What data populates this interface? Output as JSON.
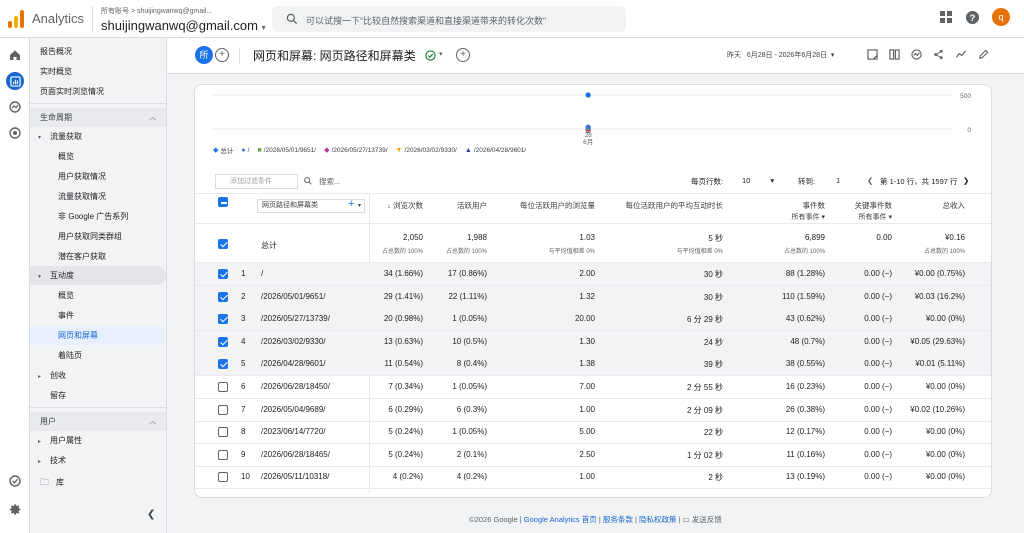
{
  "app": {
    "name": "Analytics",
    "account_path": "所有账号 > shuijingwanwq@gmail...",
    "account_name": "shuijingwanwq@gmail.com",
    "avatar_letter": "q"
  },
  "search": {
    "placeholder": "可以试搜一下“比较自然搜索渠道和直接渠道带来的转化次数”"
  },
  "nav": {
    "items": [
      {
        "label": "报告概况",
        "top": 4,
        "type": "top"
      },
      {
        "label": "实时概览",
        "top": 24,
        "type": "top"
      },
      {
        "label": "页面实时浏览情况",
        "top": 44,
        "type": "top"
      },
      {
        "label": "生命周期",
        "top": 70,
        "type": "sec"
      },
      {
        "label": "流量获取",
        "top": 89,
        "type": "group",
        "arrow": "▾"
      },
      {
        "label": "概览",
        "top": 109,
        "type": "sub"
      },
      {
        "label": "用户获取情况",
        "top": 129,
        "type": "sub"
      },
      {
        "label": "流量获取情况",
        "top": 149,
        "type": "sub"
      },
      {
        "label": "非 Google 广告系列",
        "top": 169,
        "type": "sub"
      },
      {
        "label": "用户获取同类群组",
        "top": 189,
        "type": "sub"
      },
      {
        "label": "潜在客户获取",
        "top": 209,
        "type": "sub"
      },
      {
        "label": "互动度",
        "top": 228,
        "type": "group-open",
        "arrow": "▾"
      },
      {
        "label": "概览",
        "top": 248,
        "type": "sub"
      },
      {
        "label": "事件",
        "top": 268,
        "type": "sub"
      },
      {
        "label": "网页和屏幕",
        "top": 288,
        "type": "sub-sel"
      },
      {
        "label": "着陆页",
        "top": 308,
        "type": "sub"
      },
      {
        "label": "创收",
        "top": 328,
        "type": "group",
        "arrow": "▸"
      },
      {
        "label": "留存",
        "top": 348,
        "type": "group",
        "arrow": ""
      },
      {
        "label": "用户",
        "top": 374,
        "type": "sec"
      },
      {
        "label": "用户属性",
        "top": 393,
        "type": "group",
        "arrow": "▸"
      },
      {
        "label": "技术",
        "top": 413,
        "type": "group",
        "arrow": "▸"
      },
      {
        "label": "库",
        "top": 435,
        "type": "lib"
      }
    ]
  },
  "header": {
    "title": "网页和屏幕: 网页路径和屏幕类",
    "badge": "所",
    "date_label": "昨天",
    "date_range": "6月28日 - 2026年6月28日"
  },
  "chart_data": {
    "type": "line",
    "x": [
      "6月28"
    ],
    "x_tick_labels": [
      "28",
      "6月"
    ],
    "y_ticks": [
      0,
      500
    ],
    "ylim": [
      0,
      500
    ],
    "series": [
      {
        "name": "总计",
        "color": "#1a73e8",
        "values": [
          2050
        ]
      },
      {
        "name": "/",
        "color": "#3c78d8",
        "values": [
          34
        ]
      },
      {
        "name": "/2026/05/01/9651/",
        "color": "#5ea84a",
        "values": [
          29
        ]
      },
      {
        "name": "/2026/05/27/13739/",
        "color": "#c2309e",
        "values": [
          20
        ]
      },
      {
        "name": "/2026/03/02/9330/",
        "color": "#f2a600",
        "values": [
          13
        ]
      },
      {
        "name": "/2026/04/28/9601/",
        "color": "#3b3ba8",
        "values": [
          11
        ]
      }
    ]
  },
  "legend": [
    {
      "shape": "◆",
      "color": "#1a73e8",
      "label": "总计"
    },
    {
      "shape": "●",
      "color": "#3c78d8",
      "label": "/"
    },
    {
      "shape": "■",
      "color": "#5ea84a",
      "label": "/2026/05/01/9651/"
    },
    {
      "shape": "◆",
      "color": "#c2309e",
      "label": "/2026/05/27/13739/"
    },
    {
      "shape": "▼",
      "color": "#f2a600",
      "label": "/2026/03/02/9330/"
    },
    {
      "shape": "▲",
      "color": "#3b3ba8",
      "label": "/2026/04/28/9601/"
    }
  ],
  "toolbar": {
    "filter_placeholder": "添加过滤条件",
    "search_placeholder": "搜索...",
    "rows_per_page_label": "每页行数:",
    "rows_per_page": "10",
    "goto_label": "转到:",
    "goto_value": "1",
    "pagination": "第 1-10 行，共 1597 行"
  },
  "table": {
    "dimension": "网页路径和屏幕类",
    "headers": [
      {
        "label": "↓ 浏览次数",
        "sub": ""
      },
      {
        "label": "活跃用户",
        "sub": ""
      },
      {
        "label": "每位活跃用户的浏览量",
        "sub": ""
      },
      {
        "label": "每位活跃用户的平均互动时长",
        "sub": ""
      },
      {
        "label": "事件数",
        "sub": "所有事件 ▾"
      },
      {
        "label": "关键事件数",
        "sub": "所有事件 ▾"
      },
      {
        "label": "总收入",
        "sub": ""
      }
    ],
    "total": {
      "label": "总计",
      "values": [
        "2,050",
        "1,988",
        "1.03",
        "5 秒",
        "6,899",
        "0.00",
        "¥0.16"
      ],
      "subs": [
        "占总数的 100%",
        "占总数的 100%",
        "与平均值相差 0%",
        "与平均值相差 0%",
        "占总数的 100%",
        "",
        "占总数的 100%"
      ]
    },
    "rows": [
      {
        "n": "1",
        "path": "/",
        "checked": true,
        "v": [
          "34 (1.66%)",
          "17 (0.86%)",
          "2.00",
          "30 秒",
          "88 (1.28%)",
          "0.00 (−)",
          "¥0.00 (0.75%)"
        ]
      },
      {
        "n": "2",
        "path": "/2026/05/01/9651/",
        "checked": true,
        "v": [
          "29 (1.41%)",
          "22 (1.11%)",
          "1.32",
          "30 秒",
          "110 (1.59%)",
          "0.00 (−)",
          "¥0.03 (16.2%)"
        ]
      },
      {
        "n": "3",
        "path": "/2026/05/27/13739/",
        "checked": true,
        "v": [
          "20 (0.98%)",
          "1 (0.05%)",
          "20.00",
          "6 分 29 秒",
          "43 (0.62%)",
          "0.00 (−)",
          "¥0.00 (0%)"
        ]
      },
      {
        "n": "4",
        "path": "/2026/03/02/9330/",
        "checked": true,
        "v": [
          "13 (0.63%)",
          "10 (0.5%)",
          "1.30",
          "24 秒",
          "48 (0.7%)",
          "0.00 (−)",
          "¥0.05 (29.63%)"
        ]
      },
      {
        "n": "5",
        "path": "/2026/04/28/9601/",
        "checked": true,
        "v": [
          "11 (0.54%)",
          "8 (0.4%)",
          "1.38",
          "39 秒",
          "38 (0.55%)",
          "0.00 (−)",
          "¥0.01 (5.11%)"
        ]
      },
      {
        "n": "6",
        "path": "/2026/06/28/18450/",
        "checked": false,
        "v": [
          "7 (0.34%)",
          "1 (0.05%)",
          "7.00",
          "2 分 55 秒",
          "16 (0.23%)",
          "0.00 (−)",
          "¥0.00 (0%)"
        ]
      },
      {
        "n": "7",
        "path": "/2026/05/04/9689/",
        "checked": false,
        "v": [
          "6 (0.29%)",
          "6 (0.3%)",
          "1.00",
          "2 分 09 秒",
          "26 (0.38%)",
          "0.00 (−)",
          "¥0.02 (10.26%)"
        ]
      },
      {
        "n": "8",
        "path": "/2023/06/14/7720/",
        "checked": false,
        "v": [
          "5 (0.24%)",
          "1 (0.05%)",
          "5.00",
          "22 秒",
          "12 (0.17%)",
          "0.00 (−)",
          "¥0.00 (0%)"
        ]
      },
      {
        "n": "9",
        "path": "/2026/06/28/18465/",
        "checked": false,
        "v": [
          "5 (0.24%)",
          "2 (0.1%)",
          "2.50",
          "1 分 02 秒",
          "11 (0.16%)",
          "0.00 (−)",
          "¥0.00 (0%)"
        ]
      },
      {
        "n": "10",
        "path": "/2026/05/11/10318/",
        "checked": false,
        "v": [
          "4 (0.2%)",
          "4 (0.2%)",
          "1.00",
          "2 秒",
          "13 (0.19%)",
          "0.00 (−)",
          "¥0.00 (0%)"
        ]
      }
    ]
  },
  "footer": {
    "copyright": "©2026 Google |",
    "l1": "Google Analytics 首页",
    "sep1": " | ",
    "l2": "服务条款",
    "sep2": " | ",
    "l3": "隐私权政策",
    "sep3": " | ",
    "feedback": "发送反馈"
  }
}
